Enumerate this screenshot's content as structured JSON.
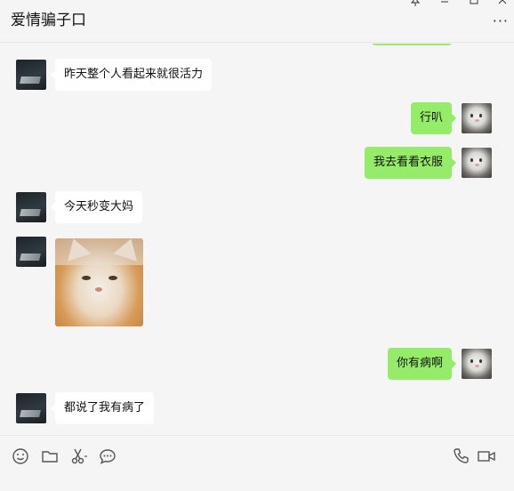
{
  "window": {
    "title": "爱情骗子口",
    "controls": [
      "pin-icon",
      "minimize-icon",
      "maximize-icon",
      "close-icon"
    ],
    "more_label": "···"
  },
  "messages": [
    {
      "side": "in",
      "type": "text",
      "text": "昨天整个人看起来就很活力"
    },
    {
      "side": "out",
      "type": "text",
      "text": "行叭"
    },
    {
      "side": "out",
      "type": "text",
      "text": "我去看看衣服"
    },
    {
      "side": "in",
      "type": "text",
      "text": "今天秒变大妈"
    },
    {
      "side": "in",
      "type": "sticker",
      "sticker": "cat-sticker"
    },
    {
      "side": "out",
      "type": "text",
      "text": "你有病啊"
    },
    {
      "side": "in",
      "type": "text",
      "text": "都说了我有病了"
    }
  ],
  "toolbar": {
    "left_icons": [
      "emoji-icon",
      "folder-icon",
      "scissors-icon",
      "chat-history-icon"
    ],
    "right_icons": [
      "phone-icon",
      "video-call-icon"
    ]
  },
  "colors": {
    "background": "#f5f5f5",
    "incoming_bubble": "#ffffff",
    "outgoing_bubble": "#95ec69"
  }
}
